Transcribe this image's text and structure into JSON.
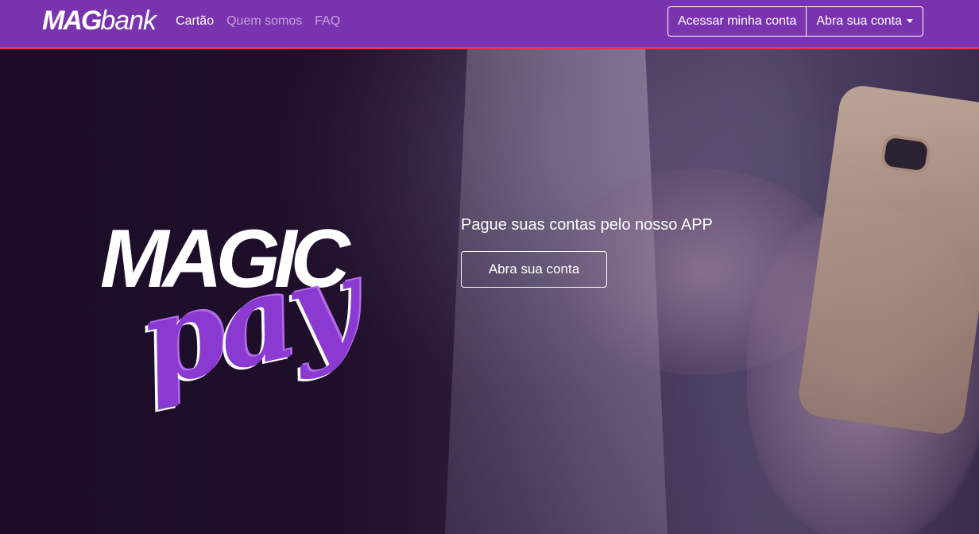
{
  "brand": {
    "bold": "MAG",
    "light": "bank"
  },
  "nav": {
    "links": [
      {
        "label": "Cartão",
        "active": true
      },
      {
        "label": "Quem somos",
        "active": false
      },
      {
        "label": "FAQ",
        "active": false
      }
    ],
    "login_button": "Acessar minha conta",
    "open_account_button": "Abra sua conta"
  },
  "hero": {
    "logo_top": "MAGIC",
    "logo_bottom": "pay",
    "tagline": "Pague suas contas pelo nosso APP",
    "cta_button": "Abra sua conta"
  },
  "colors": {
    "navbar": "#7a33ae",
    "navbar_border": "#e0374e",
    "accent_purple": "#8a3ad0"
  }
}
